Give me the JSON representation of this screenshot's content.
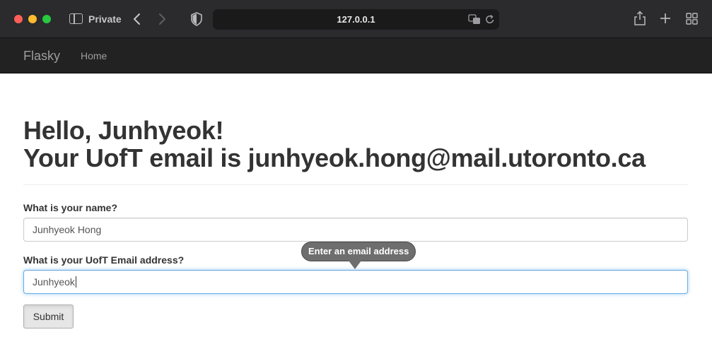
{
  "browser": {
    "private_label": "Private",
    "url": "127.0.0.1",
    "icons": [
      "sidebar-icon",
      "back-icon",
      "forward-icon",
      "shield-icon",
      "translate-icon",
      "reload-icon",
      "share-icon",
      "plus-icon",
      "tabs-overview-icon"
    ]
  },
  "navbar": {
    "brand": "Flasky",
    "home_link": "Home"
  },
  "page": {
    "greeting": "Hello, Junhyeok!",
    "email_line": "Your UofT email is junhyeok.hong@mail.utoronto.ca"
  },
  "form": {
    "name_label": "What is your name?",
    "name_value": "Junhyeok Hong",
    "email_label": "What is your UofT Email address?",
    "email_value": "Junhyeok",
    "validation_tooltip": "Enter an email address",
    "submit_label": "Submit"
  },
  "colors": {
    "navbar_bg": "#222222",
    "focus_border": "#66afe9",
    "traffic_red": "#ff5f57",
    "traffic_yellow": "#febc2e",
    "traffic_green": "#28c840"
  }
}
